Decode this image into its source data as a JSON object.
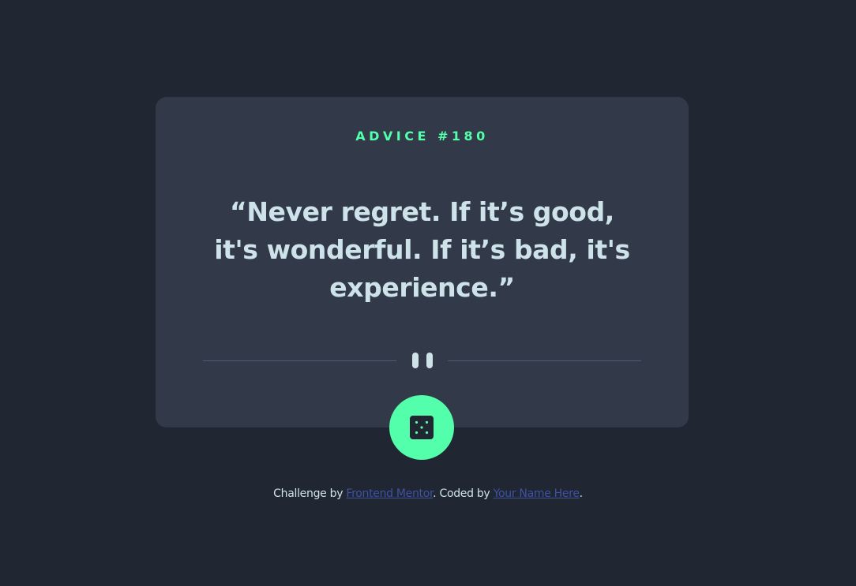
{
  "card": {
    "advice_label": "ADVICE #180",
    "quote": "“Never regret. If it’s good, it's wonderful. If it’s bad, it's experience.”"
  },
  "divider": {
    "icon": "pause-icon"
  },
  "dice_button": {
    "icon": "dice-icon"
  },
  "attribution": {
    "prefix": "Challenge by ",
    "link1": "Frontend Mentor",
    "middle": ". Coded by ",
    "link2": "Your Name Here",
    "suffix": "."
  },
  "colors": {
    "background": "#202632",
    "card": "#323a49",
    "accent": "#53ffaa",
    "text": "#cee3e9",
    "divider": "#4f5d74",
    "link": "#3e52a3"
  }
}
